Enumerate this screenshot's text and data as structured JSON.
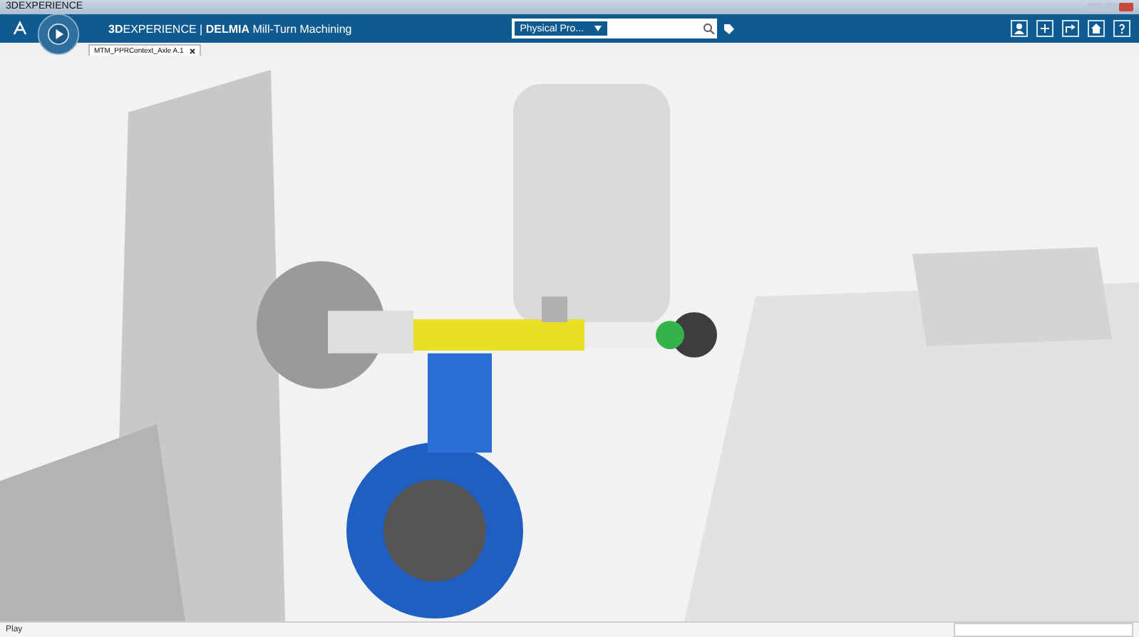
{
  "window": {
    "title": "3DEXPERIENCE"
  },
  "header": {
    "brand": "**3D**EXPERIENCE | **DELMIA** Mill-Turn Machining",
    "search_scope": "Physical Pro..."
  },
  "tabs": [
    {
      "label": "MTM_PPRContext_Axle A.1",
      "selected": true
    }
  ],
  "status_bar": {
    "message": "Play"
  }
}
